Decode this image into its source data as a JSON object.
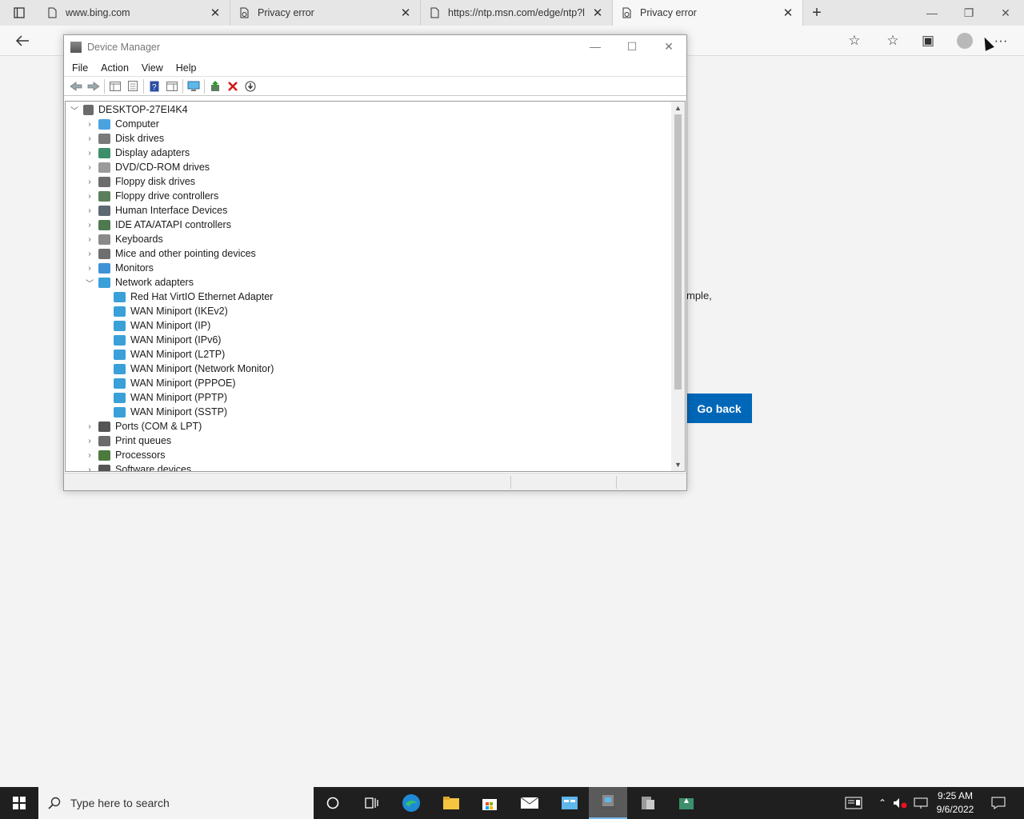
{
  "browser": {
    "tabs": [
      {
        "title": "www.bing.com",
        "icon": "page-icon"
      },
      {
        "title": "Privacy error",
        "icon": "warning-page-icon"
      },
      {
        "title": "https://ntp.msn.com/edge/ntp?l",
        "icon": "page-icon"
      },
      {
        "title": "Privacy error",
        "icon": "warning-page-icon",
        "active": true
      }
    ],
    "close_glyph": "✕",
    "new_tab_glyph": "+",
    "page_text": "mple,",
    "go_back_label": "Go back",
    "more_glyph": "···"
  },
  "device_manager": {
    "title": "Device Manager",
    "menu": [
      "File",
      "Action",
      "View",
      "Help"
    ],
    "root": "DESKTOP-27EI4K4",
    "categories": [
      {
        "label": "Computer",
        "color": "#4aa3df"
      },
      {
        "label": "Disk drives",
        "color": "#7a7a7a"
      },
      {
        "label": "Display adapters",
        "color": "#3c8f6a"
      },
      {
        "label": "DVD/CD-ROM drives",
        "color": "#9a9a9a"
      },
      {
        "label": "Floppy disk drives",
        "color": "#6d6d6d"
      },
      {
        "label": "Floppy drive controllers",
        "color": "#5b7f5b"
      },
      {
        "label": "Human Interface Devices",
        "color": "#5d6a73"
      },
      {
        "label": "IDE ATA/ATAPI controllers",
        "color": "#4f7a4f"
      },
      {
        "label": "Keyboards",
        "color": "#8a8a8a"
      },
      {
        "label": "Mice and other pointing devices",
        "color": "#6f6f6f"
      },
      {
        "label": "Monitors",
        "color": "#3f93d6"
      }
    ],
    "network": {
      "label": "Network adapters",
      "children": [
        "Red Hat VirtIO Ethernet Adapter",
        "WAN Miniport (IKEv2)",
        "WAN Miniport (IP)",
        "WAN Miniport (IPv6)",
        "WAN Miniport (L2TP)",
        "WAN Miniport (Network Monitor)",
        "WAN Miniport (PPPOE)",
        "WAN Miniport (PPTP)",
        "WAN Miniport (SSTP)"
      ]
    },
    "after": [
      {
        "label": "Ports (COM & LPT)",
        "color": "#555555"
      },
      {
        "label": "Print queues",
        "color": "#6b6b6b"
      },
      {
        "label": "Processors",
        "color": "#4c7a3c"
      },
      {
        "label": "Software devices",
        "color": "#555555"
      }
    ]
  },
  "taskbar": {
    "search_placeholder": "Type here to search",
    "time": "9:25 AM",
    "date": "9/6/2022"
  },
  "colors": {
    "accent": "#0067b8",
    "network_icon": "#3aa0d8"
  }
}
